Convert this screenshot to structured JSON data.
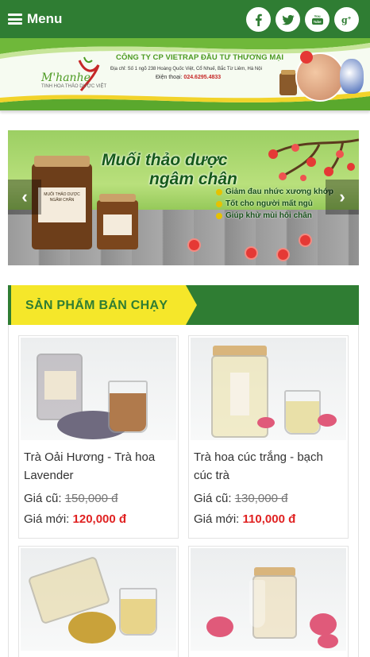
{
  "header": {
    "menu_label": "Menu",
    "socials": [
      {
        "icon": "facebook-icon",
        "glyph": "f"
      },
      {
        "icon": "twitter-icon",
        "glyph": "t"
      },
      {
        "icon": "youtube-icon",
        "glyph": "You Tube"
      },
      {
        "icon": "google-plus-icon",
        "glyph": "g+"
      }
    ]
  },
  "company": {
    "logo_text": "M'hanhe",
    "logo_subtext": "TINH HOA THẢO DƯỢC VIỆT",
    "name": "CÔNG TY CP VIETRAP ĐẦU TƯ THƯƠNG MẠI",
    "address": "Địa chỉ: Số 1 ngõ 238 Hoàng Quốc Việt, Cổ Nhuế, Bắc Từ Liêm, Hà Nội",
    "phone_label": "Điện thoại:",
    "phone": "024.6295.4833"
  },
  "slider": {
    "title_line1": "Muối thảo dược",
    "title_line2": "ngâm chân",
    "bullets": [
      "Giảm đau nhức xương khớp",
      "Tốt cho người mất ngủ",
      "Giúp khử mùi hôi chân"
    ],
    "jar_label": "MUỐI THẢO DƯỢC NGÂM CHÂN",
    "prev": "‹",
    "next": "›"
  },
  "bestsellers": {
    "title": "SẢN PHẨM BÁN CHẠY",
    "old_label": "Giá cũ:",
    "new_label": "Giá mới:",
    "products": [
      {
        "name": "Trà Oải Hương - Trà hoa Lavender",
        "old_price": "150,000 đ",
        "new_price": "120,000 đ"
      },
      {
        "name": "Trà hoa cúc trắng - bạch cúc trà",
        "old_price": "130,000 đ",
        "new_price": "110,000 đ"
      },
      {
        "name": "",
        "old_price": "",
        "new_price": ""
      },
      {
        "name": "",
        "old_price": "",
        "new_price": ""
      }
    ]
  },
  "colors": {
    "brand_green": "#2f7d33",
    "tag_yellow": "#f5e72a",
    "price_red": "#e02222"
  }
}
